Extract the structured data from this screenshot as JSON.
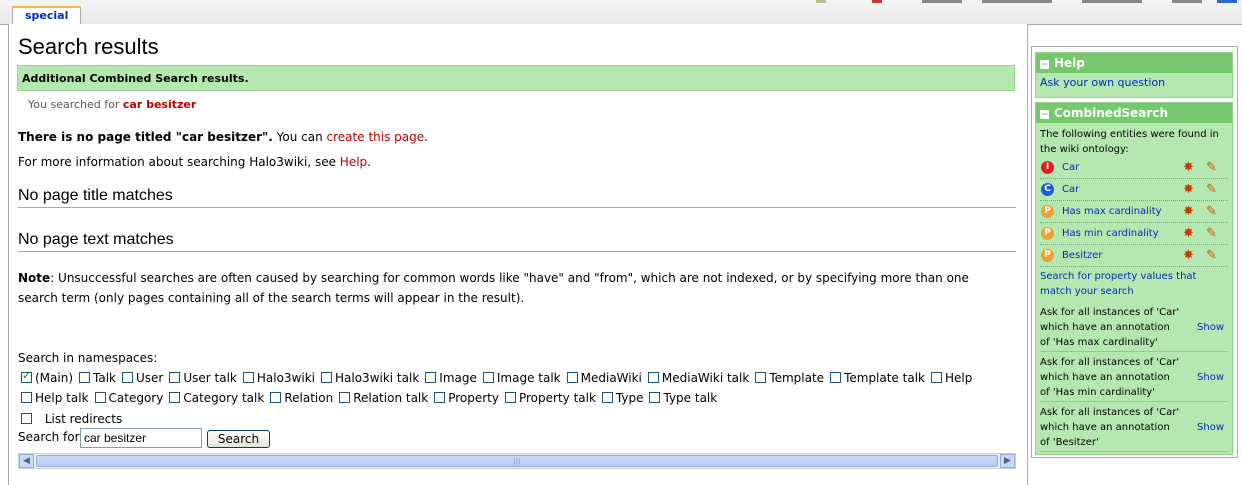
{
  "tab": {
    "label": "special"
  },
  "page": {
    "title": "Search results",
    "banner": "Additional Combined Search results.",
    "searched_prefix": "You searched for",
    "searched_term": "car besitzer",
    "no_page_bold": "There is no page titled \"car besitzer\".",
    "no_page_rest": " You can ",
    "create_link": "create this page",
    "no_page_end": ".",
    "more_info": "For more information about searching Halo3wiki, see ",
    "help_link": "Help",
    "more_info_end": ".",
    "h_title_matches": "No page title matches",
    "h_text_matches": "No page text matches",
    "note_label": "Note",
    "note_text": ": Unsuccessful searches are often caused by searching for common words like \"have\" and \"from\", which are not indexed, or by specifying more than one search term (only pages containing all of the search terms will appear in the result).",
    "ns_label": "Search in namespaces:",
    "ns_row1": [
      {
        "label": "(Main)",
        "checked": true
      },
      {
        "label": "Talk",
        "checked": false
      },
      {
        "label": "User",
        "checked": false
      },
      {
        "label": "User talk",
        "checked": false
      },
      {
        "label": "Halo3wiki",
        "checked": false
      },
      {
        "label": "Halo3wiki talk",
        "checked": false
      },
      {
        "label": "Image",
        "checked": false
      },
      {
        "label": "Image talk",
        "checked": false
      },
      {
        "label": "MediaWiki",
        "checked": false
      },
      {
        "label": "MediaWiki talk",
        "checked": false
      },
      {
        "label": "Template",
        "checked": false
      },
      {
        "label": "Template talk",
        "checked": false
      },
      {
        "label": "Help",
        "checked": false
      }
    ],
    "ns_row2": [
      {
        "label": "Help talk",
        "checked": false
      },
      {
        "label": "Category",
        "checked": false
      },
      {
        "label": "Category talk",
        "checked": false
      },
      {
        "label": "Relation",
        "checked": false
      },
      {
        "label": "Relation talk",
        "checked": false
      },
      {
        "label": "Property",
        "checked": false
      },
      {
        "label": "Property talk",
        "checked": false
      },
      {
        "label": "Type",
        "checked": false
      },
      {
        "label": "Type talk",
        "checked": false
      }
    ],
    "list_redirects": "List redirects",
    "search_for": "Search for",
    "search_value": "car besitzer",
    "search_button": "Search"
  },
  "sidebar": {
    "help_title": "Help",
    "help_link": "Ask your own question",
    "cs_title": "CombinedSearch",
    "cs_intro": "The following entities were found in the wiki ontology:",
    "entities": [
      {
        "label": "Car",
        "icon": "instance-icon",
        "icon_letter": "I",
        "color": "#e02020"
      },
      {
        "label": "Car",
        "icon": "category-icon",
        "icon_letter": "C",
        "color": "#1e5bd6"
      },
      {
        "label": "Has max cardinality",
        "icon": "property-icon",
        "icon_letter": "P",
        "color": "#f0a030"
      },
      {
        "label": "Has min cardinality",
        "icon": "property-icon",
        "icon_letter": "P",
        "color": "#f0a030"
      },
      {
        "label": "Besitzer",
        "icon": "property-icon",
        "icon_letter": "P",
        "color": "#f0a030"
      }
    ],
    "search_prop_link": "Search for property values that match your search",
    "queries": [
      {
        "text": "Ask for all instances of 'Car' which have an annotation of 'Has max cardinality'",
        "show": "Show"
      },
      {
        "text": "Ask for all instances of 'Car' which have an annotation of 'Has min cardinality'",
        "show": "Show"
      },
      {
        "text": "Ask for all instances of 'Car' which have an annotation of 'Besitzer'",
        "show": "Show"
      }
    ]
  }
}
